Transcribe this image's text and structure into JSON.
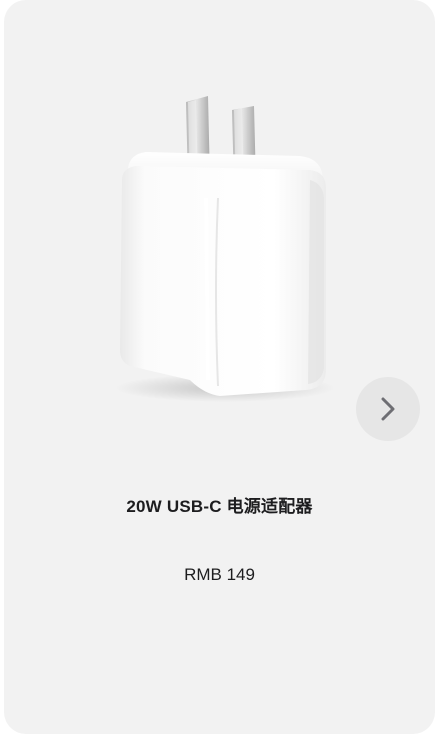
{
  "product": {
    "name": "20W USB-C 电源适配器",
    "price": "RMB 149",
    "image_icon": "power-adapter-image"
  },
  "navigation": {
    "next_icon": "chevron-right-icon"
  },
  "colors": {
    "card_background": "#f2f2f2",
    "button_background": "#e6e6e6",
    "text": "#1d1d1f",
    "chevron": "#6e6e73"
  }
}
